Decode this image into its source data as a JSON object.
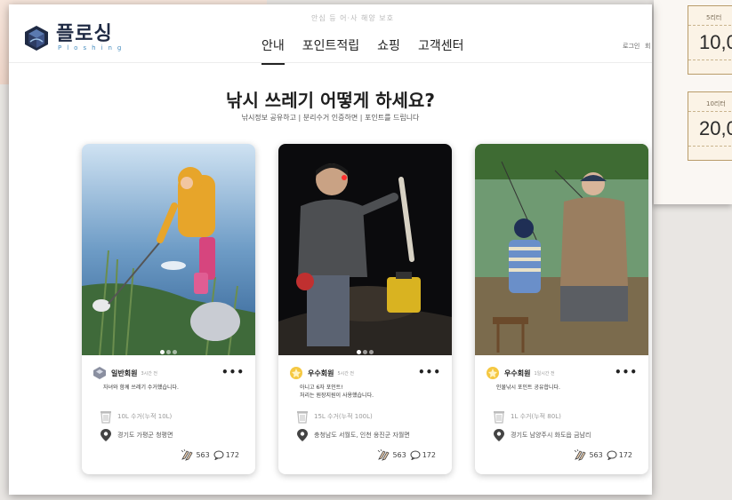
{
  "header": {
    "topline": "안심 등 어·사 해양 보호",
    "logo_kr": "플로싱",
    "logo_en": "Ploshing",
    "nav": [
      {
        "label": "안내",
        "active": true
      },
      {
        "label": "포인트적립",
        "active": false
      },
      {
        "label": "쇼핑",
        "active": false
      },
      {
        "label": "고객센터",
        "active": false
      }
    ],
    "login": "로그인",
    "login_extra": "회"
  },
  "hero": {
    "title": "낚시 쓰레기 어떻게 하세요?",
    "subtitle": "낚시정보 공유하고 | 분리수거 인증하면 | 포인트를 드립니다"
  },
  "cards": [
    {
      "member": "일반회원",
      "time": "3시간 전",
      "desc_lines": [
        "자녀와 함께 쓰레기 수거했습니다."
      ],
      "collected": "10L 수거(누적 10L)",
      "location": "경기도 가평군 청평면",
      "likes": "563",
      "comments": "172"
    },
    {
      "member": "우수회원",
      "time": "5시간 전",
      "desc_lines": [
        "아니고 6자 포인트!",
        "처리는 원장지원이 사용했습니다."
      ],
      "collected": "15L 수거(누적 100L)",
      "location": "충청남도 서월도, 인천 옹진군 자월면",
      "likes": "563",
      "comments": "172"
    },
    {
      "member": "우수회원",
      "time": "1일시간 전",
      "desc_lines": [
        "인물낚시 포인트 공유합니다."
      ],
      "collected": "1L 수거(누적 80L)",
      "location": "경기도 남양주시 화도읍 금남리",
      "likes": "563",
      "comments": "172"
    }
  ],
  "side_cards": [
    {
      "label": "5리터",
      "value": "10,0"
    },
    {
      "label": "10리터",
      "value": "20,0"
    }
  ],
  "colors": {
    "logo_navy": "#1f2a44",
    "logo_blue": "#4a8fc0",
    "premium_badge": "#f5c842",
    "standard_badge": "#8a8fa0"
  },
  "icons": {
    "logo": "hexagon-cube-logo-icon",
    "trash": "trash-can-icon",
    "location": "map-pin-icon",
    "likes": "clapping-hands-icon",
    "comments": "speech-bubble-icon",
    "more": "more-dots-icon"
  }
}
